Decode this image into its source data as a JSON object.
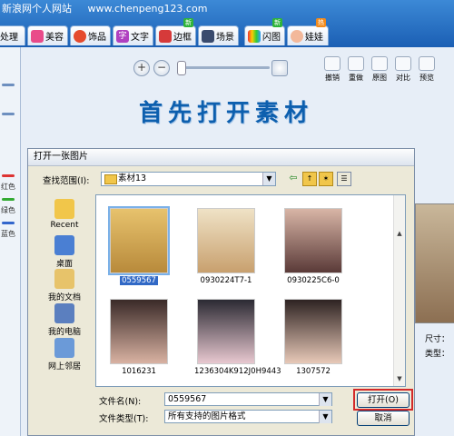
{
  "header": {
    "title": "新浪网个人网站",
    "url": "www.chenpeng123.com"
  },
  "tabs": [
    {
      "label": "处理",
      "badge": ""
    },
    {
      "label": "美容",
      "badge": ""
    },
    {
      "label": "饰品",
      "badge": ""
    },
    {
      "label": "文字",
      "badge": ""
    },
    {
      "label": "边框",
      "badge": "新"
    },
    {
      "label": "场景",
      "badge": ""
    },
    {
      "label": "闪图",
      "badge": "新"
    },
    {
      "label": "娃娃",
      "badge": "热"
    }
  ],
  "left_panel": {
    "labels": [
      "红色",
      "绿色",
      "蓝色"
    ]
  },
  "toolbar": {
    "zoom_in_label": "+",
    "zoom_out_label": "−",
    "buttons": [
      "撤销",
      "重做",
      "原图",
      "对比",
      "预览"
    ]
  },
  "canvas": {
    "headline": "首先打开素材"
  },
  "right_info": {
    "size_label": "尺寸：",
    "type_label": "类型："
  },
  "dialog": {
    "title": "打开一张图片",
    "lookin_label": "查找范围(I):",
    "lookin_value": "素材13",
    "places": [
      "Recent",
      "桌面",
      "我的文档",
      "我的电脑",
      "网上邻居"
    ],
    "files": [
      "0559567",
      "0930224T7-1",
      "0930225C6-0",
      "1016231",
      "1236304K912J0H9443",
      "1307572"
    ],
    "filename_label": "文件名(N):",
    "filename_value": "0559567",
    "filetype_label": "文件类型(T):",
    "filetype_value": "所有支持的图片格式",
    "open_label": "打开(O)",
    "cancel_label": "取消"
  },
  "colors": {
    "accent": "#1b5fb4",
    "highlight": "#d42a2a",
    "selection": "#3169c6"
  }
}
